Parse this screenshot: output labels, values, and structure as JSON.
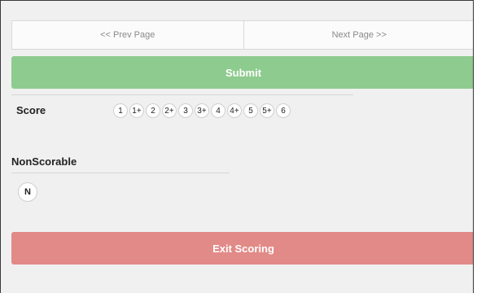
{
  "pager": {
    "prev_label": "<< Prev Page",
    "next_label": "Next Page >>"
  },
  "submit_label": "Submit",
  "score": {
    "label": "Score",
    "options": [
      "1",
      "1+",
      "2",
      "2+",
      "3",
      "3+",
      "4",
      "4+",
      "5",
      "5+",
      "6"
    ]
  },
  "nonscorable": {
    "label": "NonScorable",
    "option": "N"
  },
  "exit_label": "Exit Scoring",
  "colors": {
    "submit": "#8ecb8e",
    "exit": "#e28a87",
    "background": "#f0f0f0"
  }
}
